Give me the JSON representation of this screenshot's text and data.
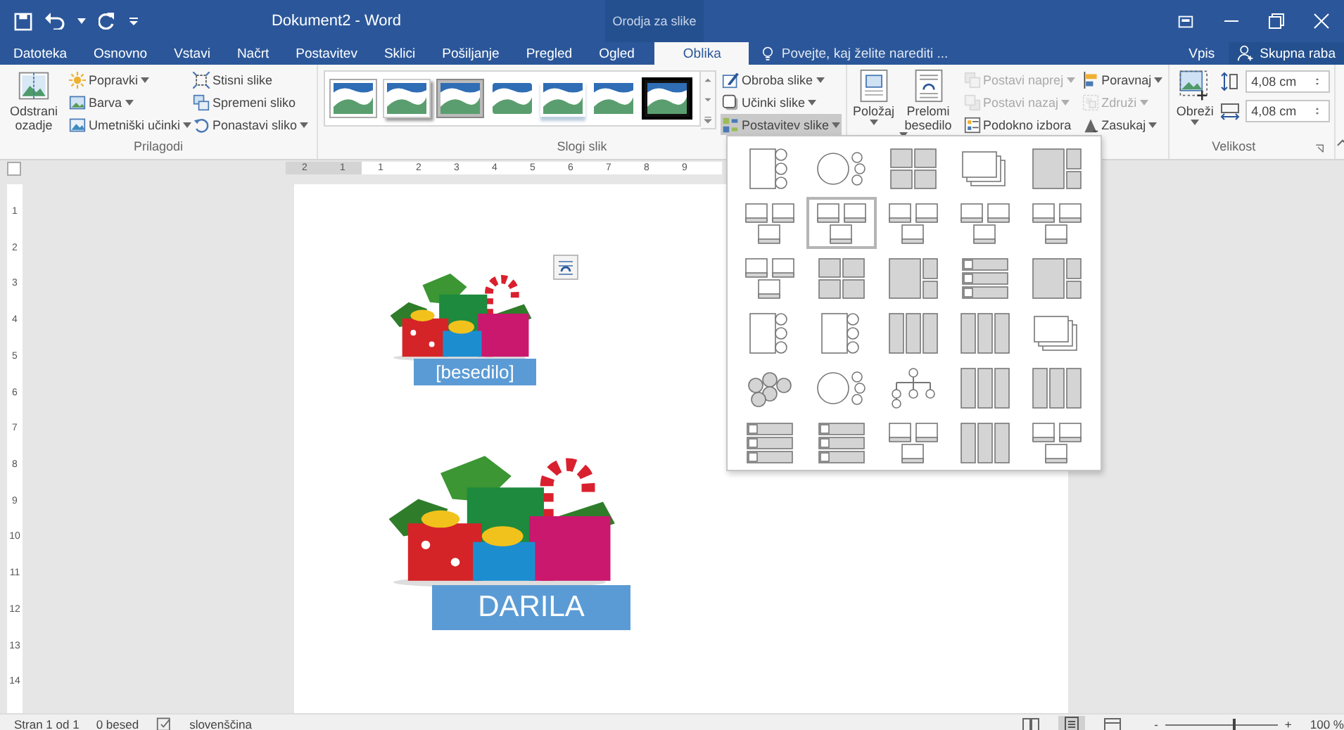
{
  "title_bar": {
    "title": "Dokument2 - Word",
    "context_tab": "Orodja za slike"
  },
  "tabs": [
    {
      "label": "Datoteka",
      "selected": false
    },
    {
      "label": "Osnovno",
      "selected": false
    },
    {
      "label": "Vstavi",
      "selected": false
    },
    {
      "label": "Načrt",
      "selected": false
    },
    {
      "label": "Postavitev",
      "selected": false
    },
    {
      "label": "Sklici",
      "selected": false
    },
    {
      "label": "Pošiljanje",
      "selected": false
    },
    {
      "label": "Pregled",
      "selected": false
    },
    {
      "label": "Ogled",
      "selected": false
    },
    {
      "label": "Oblika",
      "selected": true
    }
  ],
  "tell_me": {
    "placeholder": "Povejte, kaj želite narediti ..."
  },
  "account": {
    "sign_in": "Vpis",
    "share": "Skupna raba"
  },
  "ribbon": {
    "adjust": {
      "label": "Prilagodi",
      "remove_background": "Odstrani ozadje",
      "commands": [
        {
          "label": "Popravki",
          "dropdown": true
        },
        {
          "label": "Barva",
          "dropdown": true
        },
        {
          "label": "Umetniški učinki",
          "dropdown": true
        },
        {
          "label": "Stisni slike",
          "dropdown": false
        },
        {
          "label": "Spremeni sliko",
          "dropdown": false
        },
        {
          "label": "Ponastavi sliko",
          "dropdown": true
        }
      ]
    },
    "picture_styles": {
      "label": "Slogi slik",
      "styles": [
        {
          "kind": "white-frame"
        },
        {
          "kind": "soft-shadow"
        },
        {
          "kind": "gray-frame"
        },
        {
          "kind": "rounded"
        },
        {
          "kind": "reflection"
        },
        {
          "kind": "plain"
        },
        {
          "kind": "black-frame"
        }
      ],
      "commands": [
        {
          "label": "Obroba slike",
          "expanded": false
        },
        {
          "label": "Učinki slike",
          "expanded": false
        },
        {
          "label": "Postavitev slike",
          "expanded": true
        }
      ]
    },
    "arrange": {
      "position": "Položaj",
      "wrap_text": "Prelomi besedilo",
      "commands": [
        {
          "label": "Postavi naprej",
          "dropdown": true,
          "disabled": true
        },
        {
          "label": "Postavi nazaj",
          "dropdown": true,
          "disabled": true
        },
        {
          "label": "Podokno izbora",
          "dropdown": false,
          "disabled": false
        },
        {
          "label": "Poravnaj",
          "dropdown": true,
          "disabled": false
        },
        {
          "label": "Združi",
          "dropdown": true,
          "disabled": true
        },
        {
          "label": "Zasukaj",
          "dropdown": true,
          "disabled": false
        }
      ]
    },
    "size": {
      "label": "Velikost",
      "crop": "Obreži",
      "height": "4,08 cm",
      "width": "4,08 cm"
    }
  },
  "layout_gallery": [
    {
      "kind": "circle-list",
      "selected": false
    },
    {
      "kind": "circle-hub",
      "selected": false
    },
    {
      "kind": "grid",
      "selected": false
    },
    {
      "kind": "cascade",
      "selected": false
    },
    {
      "kind": "mosaic",
      "selected": false
    },
    {
      "kind": "captioned",
      "selected": false
    },
    {
      "kind": "captioned",
      "selected": true
    },
    {
      "kind": "captioned",
      "selected": false
    },
    {
      "kind": "captioned",
      "selected": false
    },
    {
      "kind": "captioned",
      "selected": false
    },
    {
      "kind": "captioned",
      "selected": false
    },
    {
      "kind": "grid",
      "selected": false
    },
    {
      "kind": "mosaic",
      "selected": false
    },
    {
      "kind": "strips",
      "selected": false
    },
    {
      "kind": "mosaic",
      "selected": false
    },
    {
      "kind": "circle-list",
      "selected": false
    },
    {
      "kind": "circle-list",
      "selected": false
    },
    {
      "kind": "columns",
      "selected": false
    },
    {
      "kind": "columns",
      "selected": false
    },
    {
      "kind": "cascade",
      "selected": false
    },
    {
      "kind": "hex",
      "selected": false
    },
    {
      "kind": "circle-hub",
      "selected": false
    },
    {
      "kind": "tree",
      "selected": false
    },
    {
      "kind": "columns",
      "selected": false
    },
    {
      "kind": "columns",
      "selected": false
    },
    {
      "kind": "strips",
      "selected": false
    },
    {
      "kind": "strips",
      "selected": false
    },
    {
      "kind": "captioned",
      "selected": false
    },
    {
      "kind": "columns",
      "selected": false
    },
    {
      "kind": "captioned",
      "selected": false
    }
  ],
  "document": {
    "hruler": [
      "2",
      "1",
      "1",
      "2",
      "3",
      "4",
      "5",
      "6",
      "7",
      "8",
      "9"
    ],
    "vruler": [
      "1",
      "2",
      "3",
      "4",
      "5",
      "6",
      "7",
      "8",
      "9",
      "10",
      "11",
      "12",
      "13",
      "14"
    ],
    "figures": [
      {
        "caption": "[besedilo]",
        "kind": "small",
        "selected": true
      },
      {
        "caption": "DARILA",
        "kind": "large",
        "selected": false
      }
    ]
  },
  "status_bar": {
    "page": "Stran 1 od 1",
    "words": "0 besed",
    "language": "slovenščina",
    "views": [
      {
        "kind": "read",
        "selected": false
      },
      {
        "kind": "print",
        "selected": true
      },
      {
        "kind": "web",
        "selected": false
      }
    ],
    "zoom_out": "-",
    "zoom": {
      "level": 0.6
    },
    "zoom_in": "+",
    "zoom_label": "100 %"
  }
}
